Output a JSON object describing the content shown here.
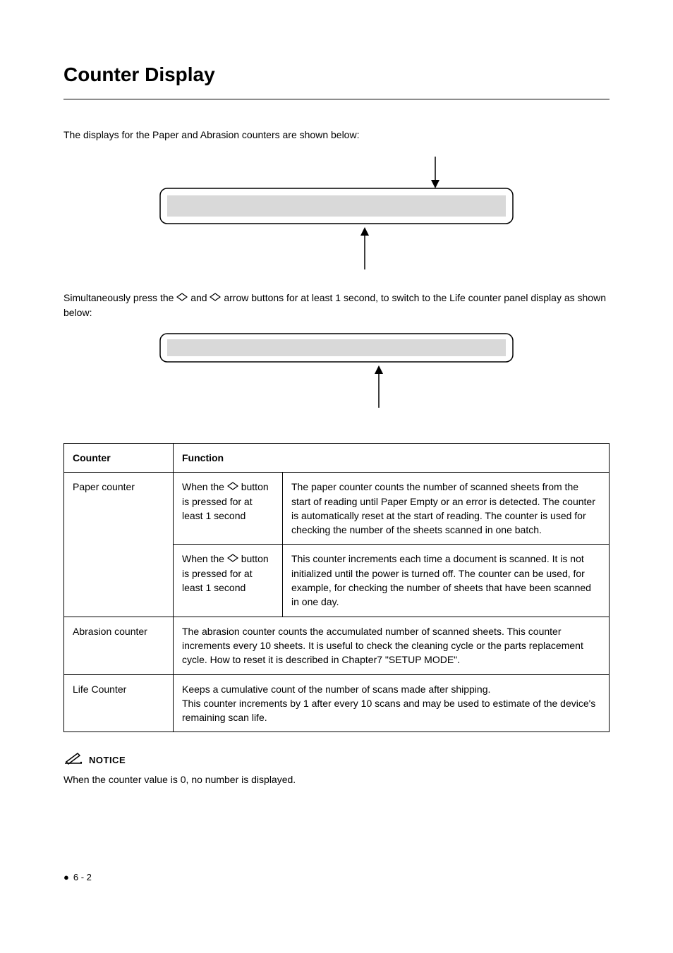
{
  "title": "Counter Display",
  "intro": "The displays for the Paper and Abrasion counters are shown below:",
  "para2_pre": "Simultaneously press the ",
  "para2_mid": " and ",
  "para2_post": " arrow buttons for at least 1 second, to switch to the Life counter panel display as shown below:",
  "table": {
    "headers": {
      "counter": "Counter",
      "function": "Function"
    },
    "rows": [
      {
        "counter": "Paper counter",
        "sub": [
          {
            "when_pre": "When the ",
            "when_post": " button is pressed for at least 1 second",
            "desc": "The paper counter counts the number of scanned sheets from the start of reading until Paper Empty or an error is detected. The counter is automatically reset at the start of reading. The counter is used for checking the number of the sheets scanned in one batch."
          },
          {
            "when_pre": "When the ",
            "when_post": " button is pressed for at least 1 second",
            "desc": "This counter increments each time a document is scanned. It is not initialized until the power is turned off. The counter can be used, for example, for checking the number of sheets that have been scanned in one day."
          }
        ]
      },
      {
        "counter": "Abrasion counter",
        "desc": "The abrasion counter counts the accumulated number of scanned sheets. This counter increments every 10 sheets. It is useful to check the cleaning cycle or the parts replacement cycle. How to reset it is described in Chapter7 \"SETUP MODE\"."
      },
      {
        "counter": "Life Counter",
        "desc": "Keeps a cumulative count of the number of scans made after shipping.\nThis counter increments by 1 after every 10 scans and may be used to estimate of the device's remaining scan life."
      }
    ]
  },
  "notice": {
    "label": "NOTICE",
    "text": "When the counter value is 0, no number is displayed."
  },
  "footer": "6 - 2",
  "icons": {
    "lozenge": "lozenge-icon",
    "pencil": "pencil-icon"
  }
}
